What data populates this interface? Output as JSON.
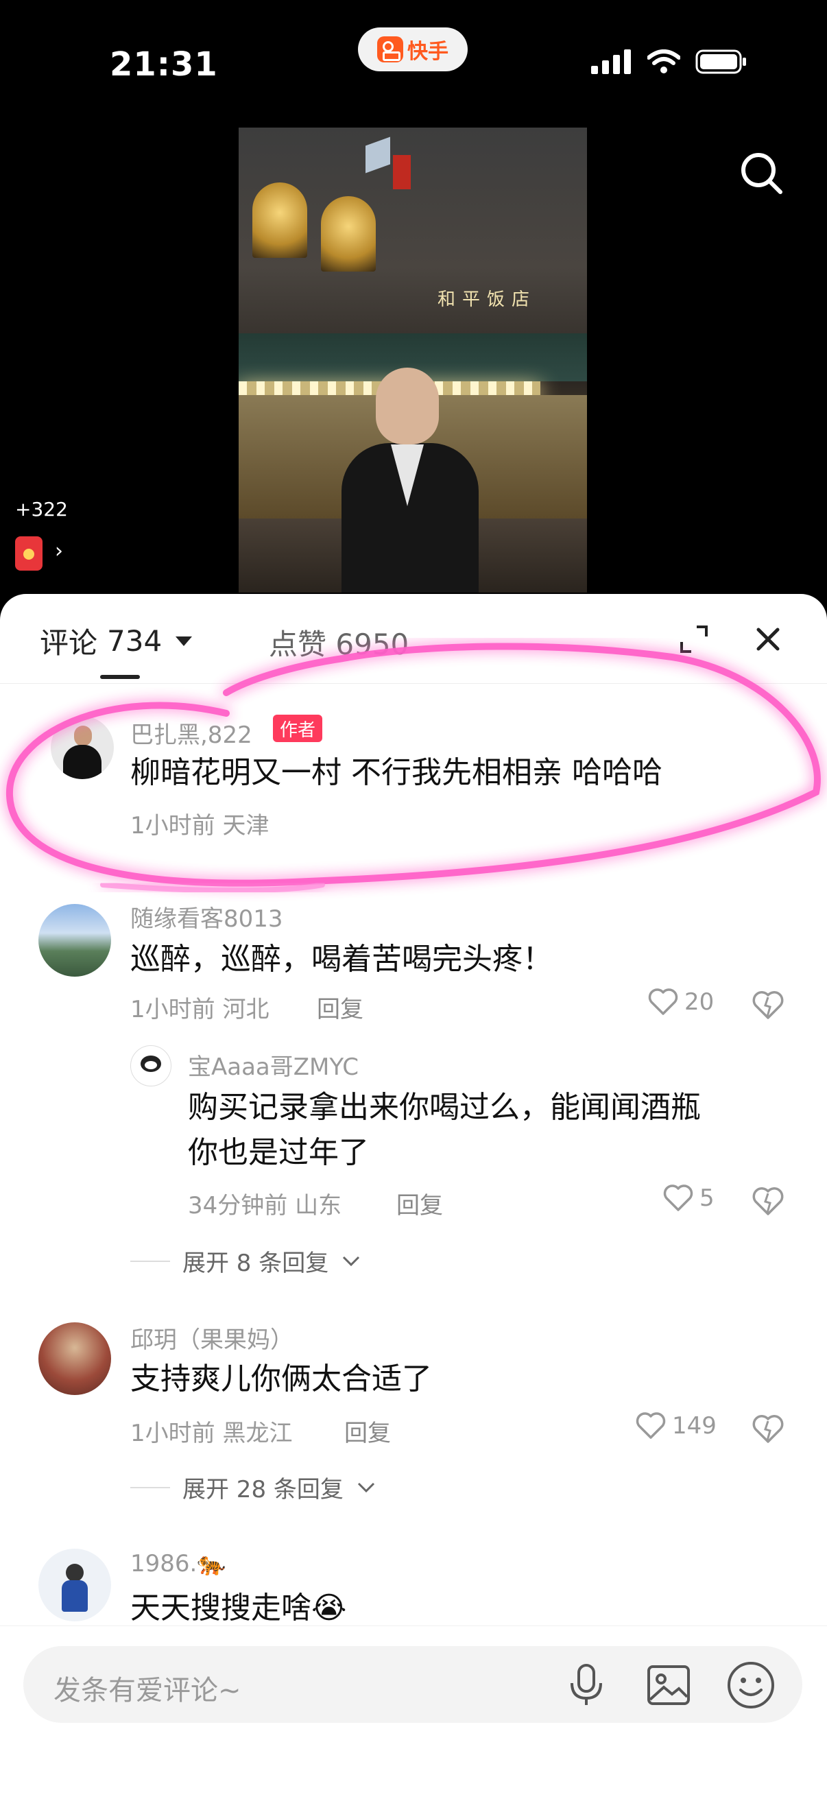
{
  "status_bar": {
    "time": "21:31",
    "app_name": "快手"
  },
  "video": {
    "sign_text": "和平饭店"
  },
  "reward": {
    "count": "+322",
    "arrow": "›"
  },
  "tabs": {
    "comments_label": "评论",
    "comments_count": "734",
    "likes_label": "点赞",
    "likes_count": "6950"
  },
  "comments": [
    {
      "user": "巴扎黑,822",
      "badge": "作者",
      "text": "柳暗花明又一村 不行我先相相亲 哈哈哈",
      "meta": "1小时前 天津"
    },
    {
      "user": "随缘看客8013",
      "text": "巡醉，巡醉，喝着苦喝完头疼！",
      "meta": "1小时前 河北",
      "reply": "回复",
      "likes": "20",
      "sub_reply": {
        "user": "宝Aaaa哥ZMYC",
        "text_line1": "购买记录拿出来你喝过么，能闻闻酒瓶",
        "text_line2": "你也是过年了",
        "meta": "34分钟前 山东",
        "reply": "回复",
        "likes": "5"
      },
      "expand": "展开 8 条回复"
    },
    {
      "user": "邱玥（果果妈）",
      "text": "支持爽儿你俩太合适了",
      "meta": "1小时前 黑龙江",
      "reply": "回复",
      "likes": "149",
      "expand": "展开 28 条回复"
    },
    {
      "user": "1986.🐅",
      "text": "天天搜搜走啥😭"
    }
  ],
  "input": {
    "placeholder": "发条有爱评论~"
  },
  "colors": {
    "accent": "#fe3a5c",
    "highlight": "#ff5fc8",
    "brand": "#ff5a1f"
  }
}
